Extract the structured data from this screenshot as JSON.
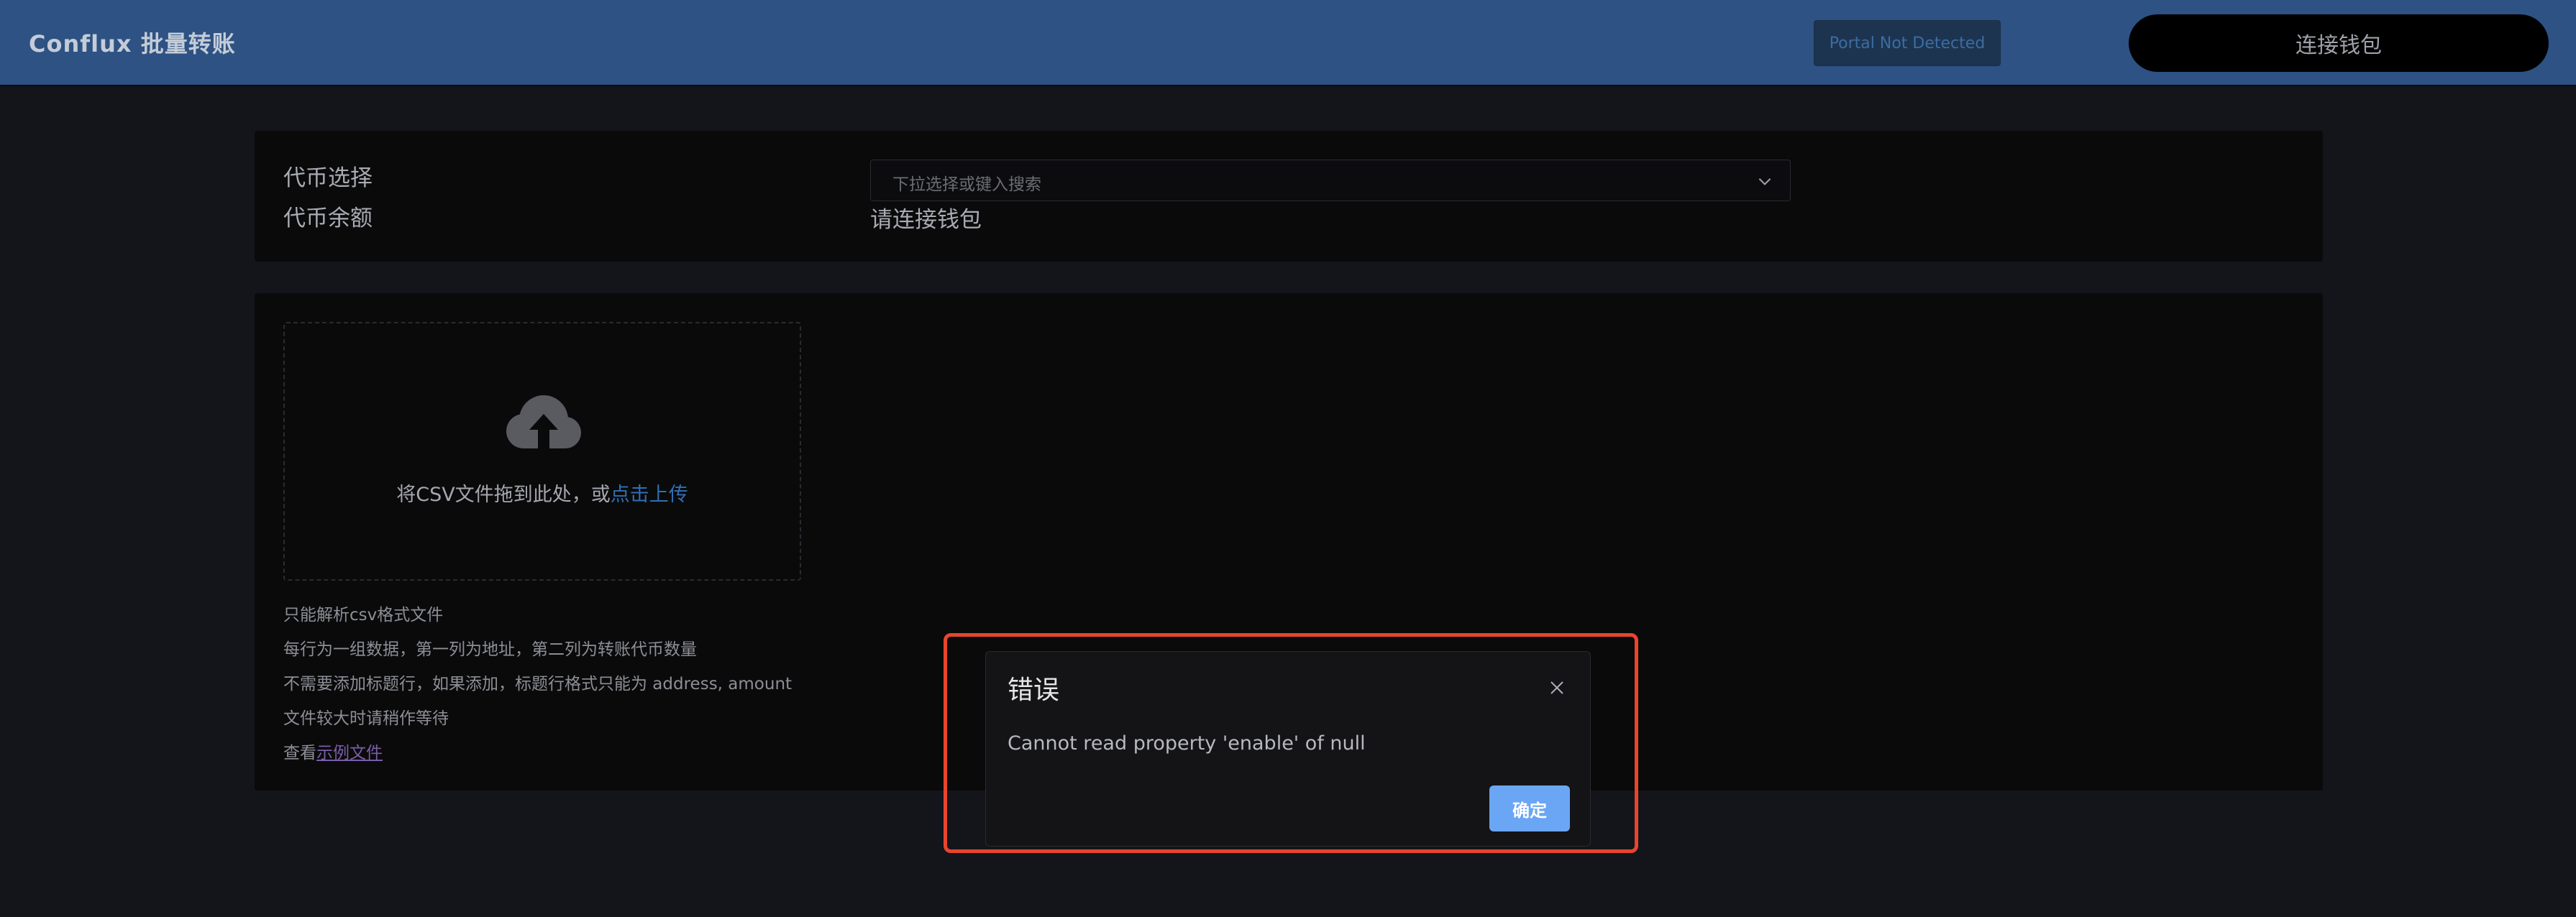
{
  "header": {
    "title": "Conflux 批量转账",
    "portal_status": "Portal Not Detected",
    "connect_wallet_label": "连接钱包"
  },
  "token_panel": {
    "token_select_label": "代币选择",
    "token_select_placeholder": "下拉选择或键入搜索",
    "balance_label": "代币余额",
    "balance_value": "请连接钱包"
  },
  "upload_panel": {
    "drop_text": "将CSV文件拖到此处，或",
    "drop_link": "点击上传",
    "hints": [
      "只能解析csv格式文件",
      "每行为一组数据，第一列为地址，第二列为转账代币数量",
      "不需要添加标题行，如果添加，标题行格式只能为 address, amount",
      "文件较大时请稍作等待"
    ],
    "example_prefix": "查看",
    "example_link": "示例文件"
  },
  "error_modal": {
    "title": "错误",
    "message": "Cannot read property 'enable' of null",
    "ok_label": "确定"
  },
  "icons": {
    "upload": "cloud-upload-icon",
    "dropdown": "chevron-down-icon",
    "close": "close-icon"
  },
  "colors": {
    "header_bg": "#2d5283",
    "link": "#2f6fb5",
    "primary_button": "#6ba6f5",
    "highlight": "#e8452c"
  }
}
